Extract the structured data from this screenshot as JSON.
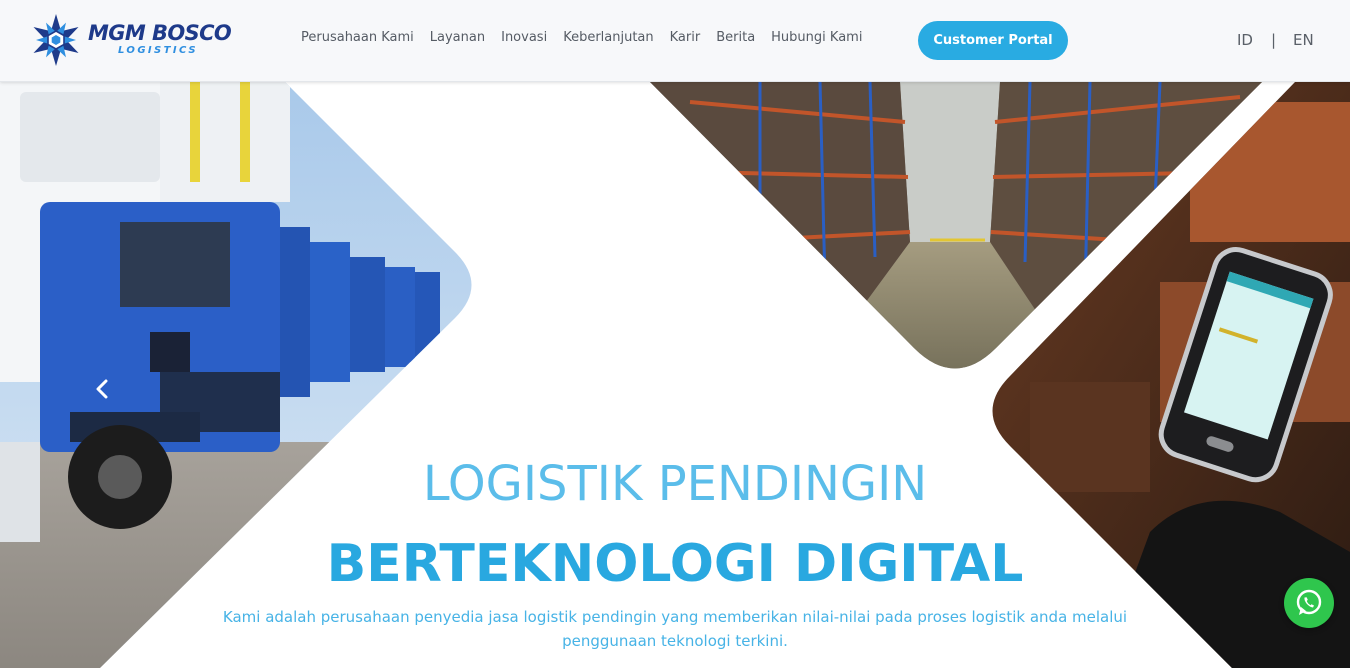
{
  "brand": {
    "name": "MGM BOSCO",
    "tagline": "LOGISTICS",
    "logo_icon": "snowflake-star-logo",
    "colors": {
      "primary": "#1e3a8a",
      "accent": "#29abe2",
      "whatsapp": "#2fc64d"
    }
  },
  "nav": {
    "items": [
      {
        "label": "Perusahaan Kami"
      },
      {
        "label": "Layanan"
      },
      {
        "label": "Inovasi"
      },
      {
        "label": "Keberlanjutan"
      },
      {
        "label": "Karir"
      },
      {
        "label": "Berita"
      },
      {
        "label": "Hubungi Kami"
      }
    ],
    "portal_label": "Customer Portal"
  },
  "lang": {
    "id_label": "ID",
    "separator": "|",
    "en_label": "EN"
  },
  "hero": {
    "headline_line1": "LOGISTIK PENDINGIN",
    "headline_line2": "BERTEKNOLOGI DIGITAL",
    "subtext": "Kami adalah perusahaan penyedia jasa logistik pendingin yang memberikan nilai-nilai pada proses logistik anda melalui penggunaan teknologi terkini.",
    "prev_icon": "chevron-left-icon"
  },
  "floating": {
    "whatsapp_icon": "whatsapp-icon"
  }
}
